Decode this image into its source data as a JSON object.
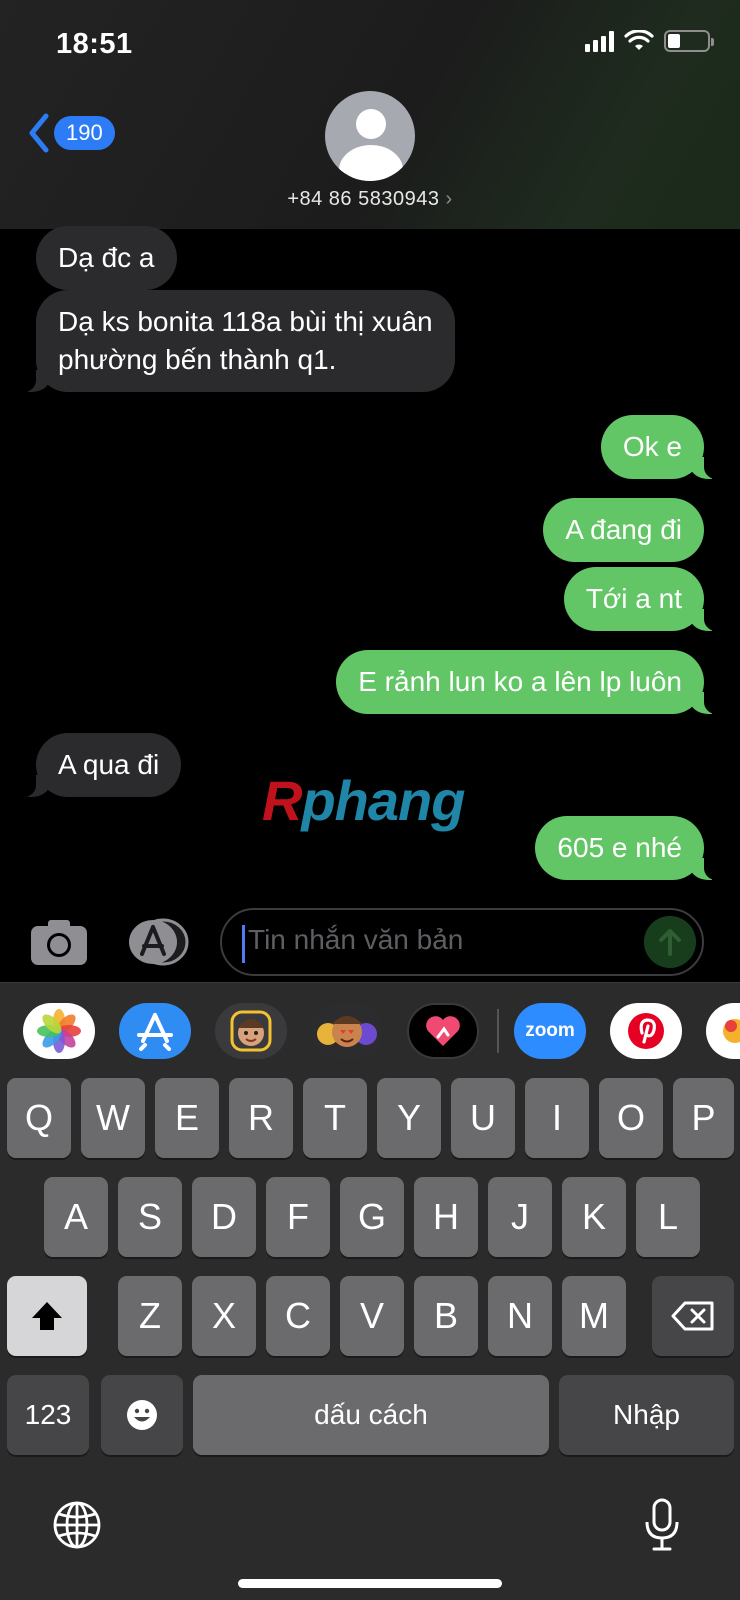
{
  "status_bar": {
    "time": "18:51"
  },
  "nav": {
    "back_count": "190",
    "contact": "+84 86 5830943",
    "contact_chevron": "›"
  },
  "messages": [
    {
      "side": "in",
      "text": "Dạ đc a"
    },
    {
      "side": "in",
      "lines": [
        "Dạ ks bonita 118a bùi thị xuân",
        "phường bến thành q1."
      ]
    },
    {
      "side": "out",
      "text": "Ok e"
    },
    {
      "side": "out",
      "text": "A đang đi"
    },
    {
      "side": "out",
      "text": "Tới a nt"
    },
    {
      "side": "out",
      "text": "E rảnh lun ko a lên lp luôn"
    },
    {
      "side": "in",
      "text": "A qua đi"
    },
    {
      "side": "out",
      "text": "605 e nhé"
    }
  ],
  "watermark": {
    "first": "R",
    "rest": "phang"
  },
  "composer": {
    "placeholder": "Tin nhắn văn bản"
  },
  "app_strip": [
    "photos-app-icon",
    "app-store-icon",
    "memoji-icon",
    "animoji-icon",
    "digital-touch-icon",
    "zoom-app-icon",
    "pinterest-app-icon",
    "partial-app-icon"
  ],
  "app_labels": {
    "zoom": "zoom"
  },
  "keyboard": {
    "row1": [
      "Q",
      "W",
      "E",
      "R",
      "T",
      "Y",
      "U",
      "I",
      "O",
      "P"
    ],
    "row2": [
      "A",
      "S",
      "D",
      "F",
      "G",
      "H",
      "J",
      "K",
      "L"
    ],
    "row3": [
      "Z",
      "X",
      "C",
      "V",
      "B",
      "N",
      "M"
    ],
    "numbers_label": "123",
    "space_label": "dấu cách",
    "return_label": "Nhập"
  },
  "colors": {
    "outgoing_bubble": "#63c666",
    "incoming_bubble": "#2b2b2d",
    "accent_blue": "#2d7cf6"
  }
}
